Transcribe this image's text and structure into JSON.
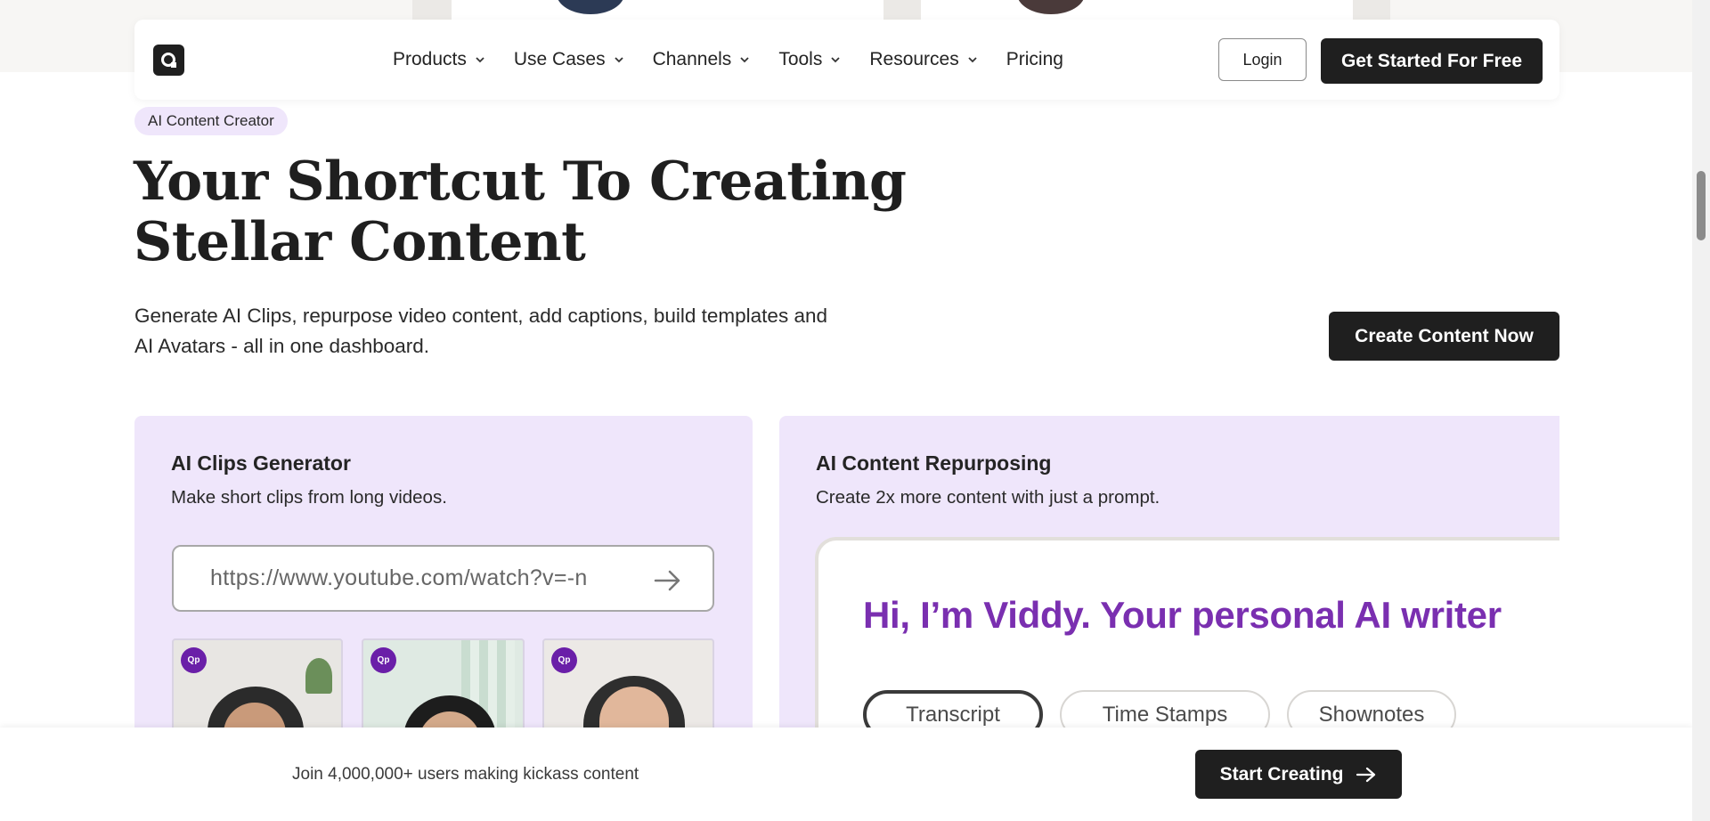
{
  "nav": {
    "logo_label": "Q",
    "items": [
      {
        "label": "Products",
        "has_dropdown": true
      },
      {
        "label": "Use Cases",
        "has_dropdown": true
      },
      {
        "label": "Channels",
        "has_dropdown": true
      },
      {
        "label": "Tools",
        "has_dropdown": true
      },
      {
        "label": "Resources",
        "has_dropdown": true
      },
      {
        "label": "Pricing",
        "has_dropdown": false
      }
    ],
    "login_label": "Login",
    "cta_label": "Get Started For Free"
  },
  "hero": {
    "badge": "AI Content Creator",
    "title_line1": "Your Shortcut To Creating",
    "title_line2": "Stellar Content",
    "subtitle_line1": "Generate AI Clips, repurpose video content, add captions, build templates and",
    "subtitle_line2": "AI Avatars - all in one dashboard.",
    "cta_label": "Create Content Now"
  },
  "clips_card": {
    "title": "AI Clips Generator",
    "description": "Make short clips from long videos.",
    "url_value": "https://www.youtube.com/watch?v=-n",
    "thumb_logo": "Qp"
  },
  "repurpose_card": {
    "title": "AI Content Repurposing",
    "description": "Create 2x more content with just a prompt.",
    "viddy_heading": "Hi, I’m Viddy. Your personal AI writer",
    "pills": [
      "Transcript",
      "Time Stamps",
      "Shownotes"
    ],
    "active_pill": "Transcript"
  },
  "bottom_bar": {
    "text": "Join 4,000,000+ users making kickass content",
    "cta_label": "Start Creating"
  },
  "colors": {
    "dark": "#1f1f1f",
    "lavender": "#efe6fb",
    "purple": "#7a2fb0"
  }
}
